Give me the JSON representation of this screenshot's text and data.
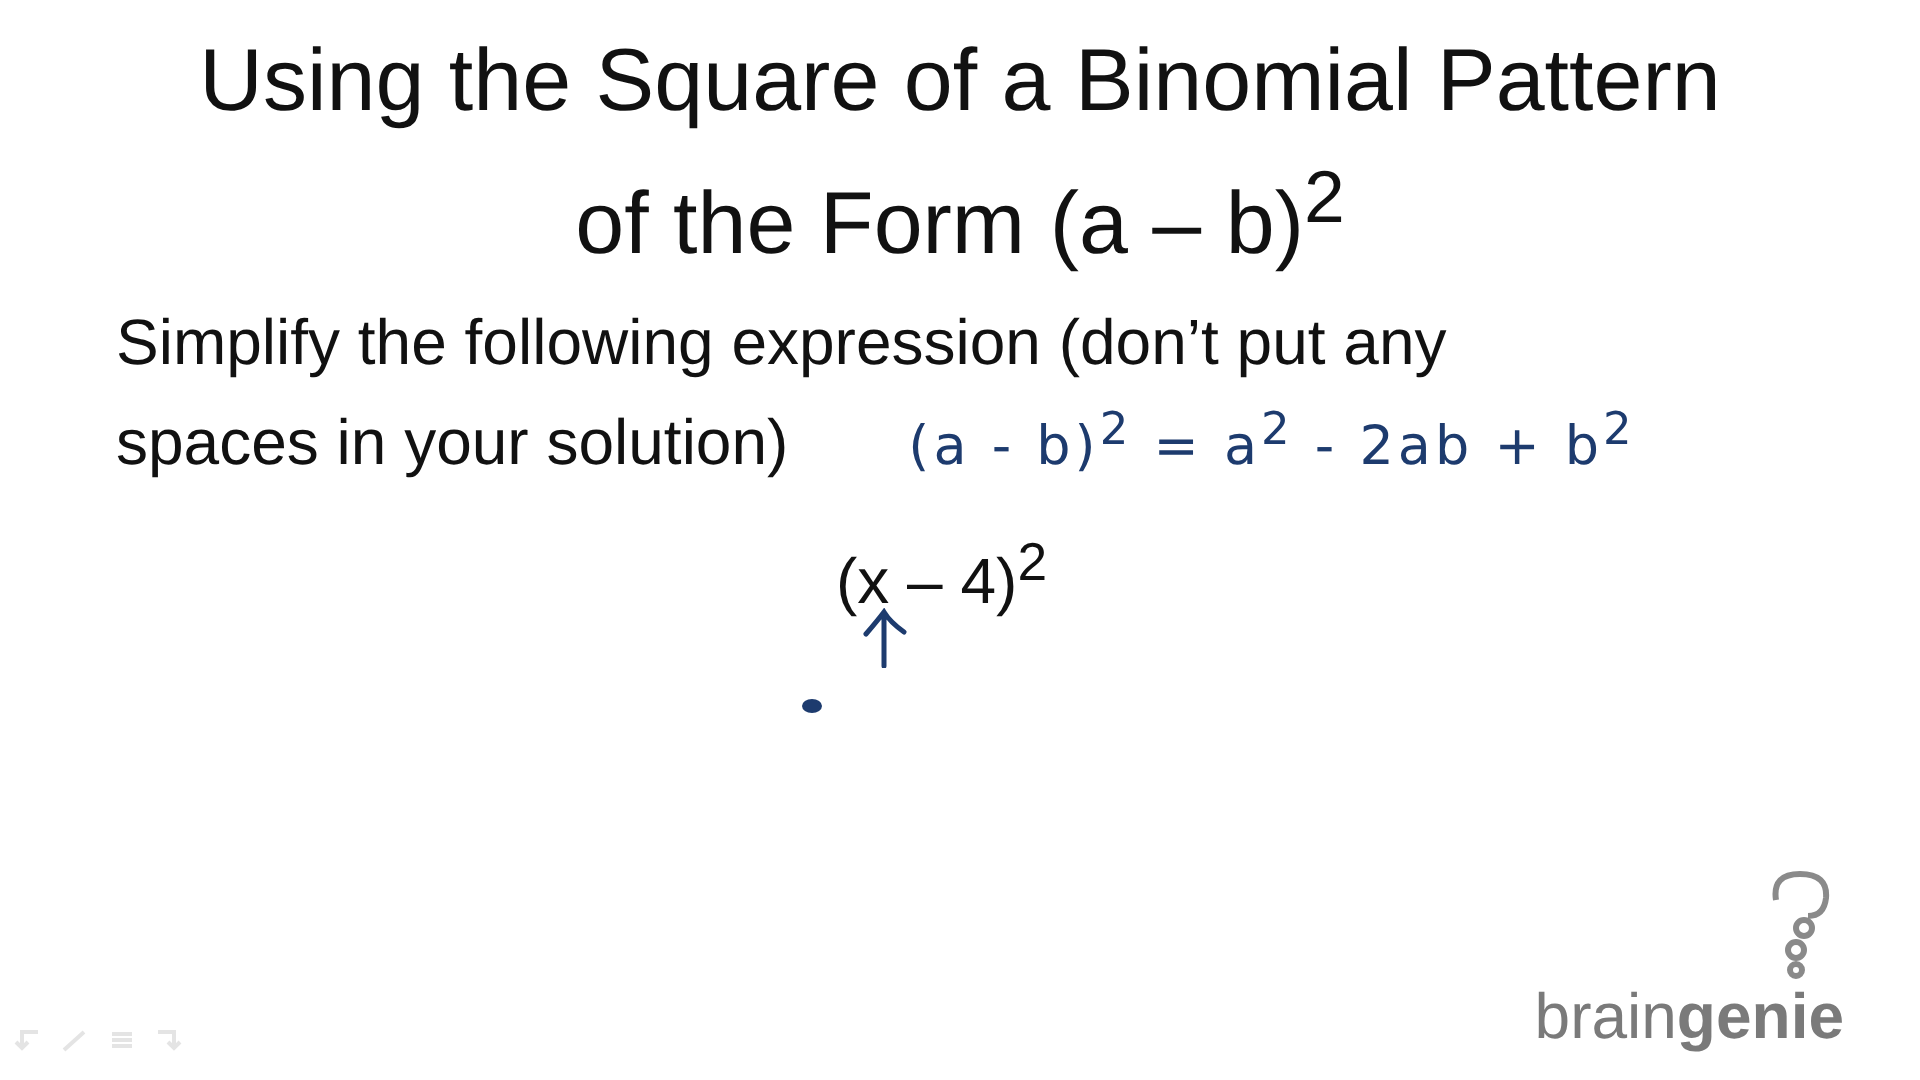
{
  "slide": {
    "title_lines": [
      "Using the Square of a Binomial Pattern",
      "of the Form (a – b)$^{2}$"
    ],
    "instruction_lines": [
      "Simplify the following expression (don’t put any",
      "spaces in your solution)"
    ],
    "handwritten_note": "(a - b)$^{2}$ = a$^{2}$ - 2ab + b$^{2}$",
    "expression": "(x – 4)$^{2}$",
    "logo": {
      "light": "brain",
      "bold": "genie"
    }
  }
}
